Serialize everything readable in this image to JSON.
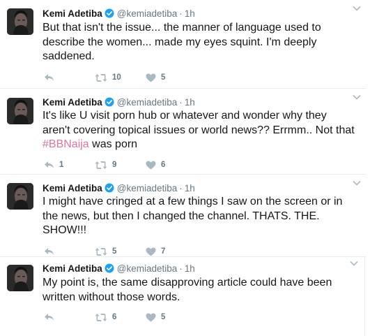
{
  "colors": {
    "text": "#14171a",
    "muted": "#657786",
    "hashtag": "#e0749a",
    "verified": "#1da1f2",
    "divider": "#e6ecf0"
  },
  "tweets": [
    {
      "name": "Kemi Adetiba",
      "handle": "@kemiadetiba",
      "separator": "·",
      "time": "1h",
      "text_before": "But that isn't the issue... the manner of language used to describe the women... made my eyes squint. I'm deeply saddened.",
      "hashtag": "",
      "text_after": "",
      "reply_count": "",
      "retweet_count": "10",
      "like_count": "5",
      "icons": {
        "reply": "reply-icon",
        "retweet": "retweet-icon",
        "like": "heart-icon",
        "more": "chevron-down-icon",
        "verified": "verified-badge-icon"
      }
    },
    {
      "name": "Kemi Adetiba",
      "handle": "@kemiadetiba",
      "separator": "·",
      "time": "1h",
      "text_before": "It's like U visit porn hub or whatever and wonder why they aren't covering topical issues or world news?? Errmm.. Not that ",
      "hashtag": "#BBNaija",
      "text_after": " was porn",
      "reply_count": "1",
      "retweet_count": "9",
      "like_count": "6",
      "icons": {
        "reply": "reply-icon",
        "retweet": "retweet-icon",
        "like": "heart-icon",
        "more": "chevron-down-icon",
        "verified": "verified-badge-icon"
      }
    },
    {
      "name": "Kemi Adetiba",
      "handle": "@kemiadetiba",
      "separator": "·",
      "time": "1h",
      "text_before": "I might have cringed at a few things I saw on the screen or in the news, but then I changed the channel. THATS. THE. SHOW!!!",
      "hashtag": "",
      "text_after": "",
      "reply_count": "",
      "retweet_count": "5",
      "like_count": "7",
      "icons": {
        "reply": "reply-icon",
        "retweet": "retweet-icon",
        "like": "heart-icon",
        "more": "chevron-down-icon",
        "verified": "verified-badge-icon"
      }
    },
    {
      "name": "Kemi Adetiba",
      "handle": "@kemiadetiba",
      "separator": "·",
      "time": "1h",
      "text_before": "My point is, the same disapproving article could have been written without those words.",
      "hashtag": "",
      "text_after": "",
      "reply_count": "",
      "retweet_count": "6",
      "like_count": "5",
      "icons": {
        "reply": "reply-icon",
        "retweet": "retweet-icon",
        "like": "heart-icon",
        "more": "chevron-down-icon",
        "verified": "verified-badge-icon"
      }
    }
  ]
}
